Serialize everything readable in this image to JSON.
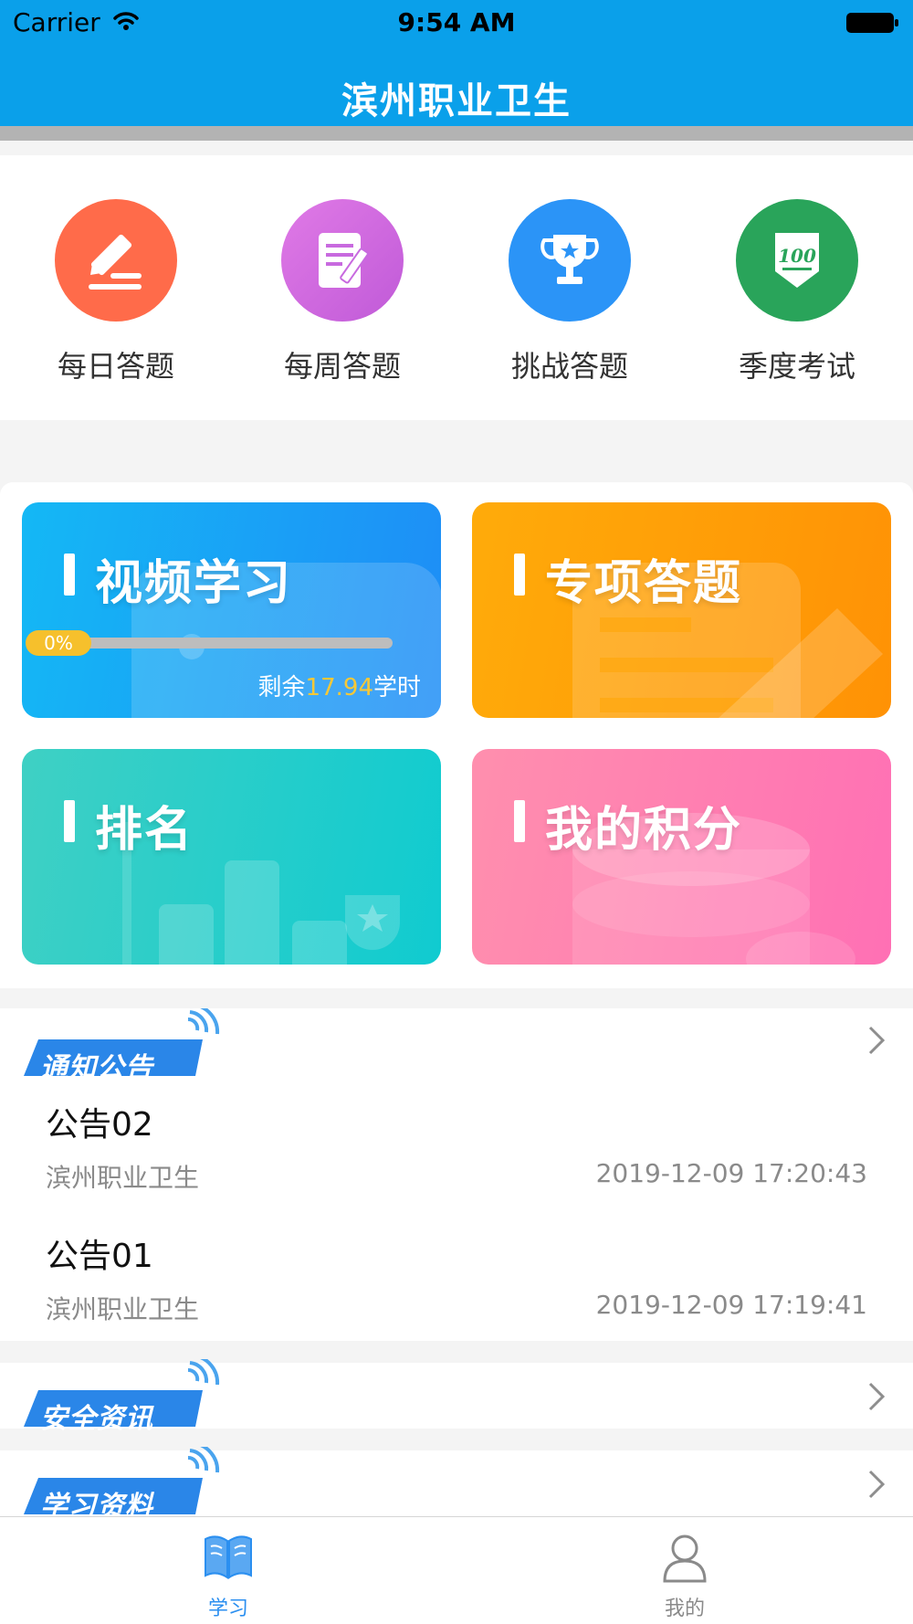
{
  "status_bar": {
    "carrier": "Carrier",
    "time": "9:54 AM"
  },
  "nav": {
    "title": "滨州职业卫生"
  },
  "quick_actions": [
    {
      "label": "每日答题",
      "icon": "pencil-icon",
      "color": "#ff6b4a"
    },
    {
      "label": "每周答题",
      "icon": "notepad-icon",
      "color": "#d86ae0"
    },
    {
      "label": "挑战答题",
      "icon": "trophy-icon",
      "color": "#2b94f7"
    },
    {
      "label": "季度考试",
      "icon": "score-100-icon",
      "color": "#29a45a"
    }
  ],
  "cards": {
    "video": {
      "title": "视频学习",
      "progress_label": "0%",
      "progress": 0,
      "remain_prefix": "剩余",
      "remain_value": "17.94",
      "remain_suffix": "学时"
    },
    "special": {
      "title": "专项答题"
    },
    "ranking": {
      "title": "排名"
    },
    "points": {
      "title": "我的积分"
    }
  },
  "sections": {
    "notices": {
      "badge": "通知公告",
      "items": [
        {
          "title": "公告02",
          "source": "滨州职业卫生",
          "time": "2019-12-09 17:20:43"
        },
        {
          "title": "公告01",
          "source": "滨州职业卫生",
          "time": "2019-12-09 17:19:41"
        }
      ]
    },
    "safety": {
      "badge": "安全资讯"
    },
    "materials": {
      "badge": "学习资料"
    }
  },
  "tabbar": {
    "study": {
      "label": "学习",
      "color": "#2b8ff0"
    },
    "mine": {
      "label": "我的",
      "color": "#8a8a8a"
    }
  }
}
